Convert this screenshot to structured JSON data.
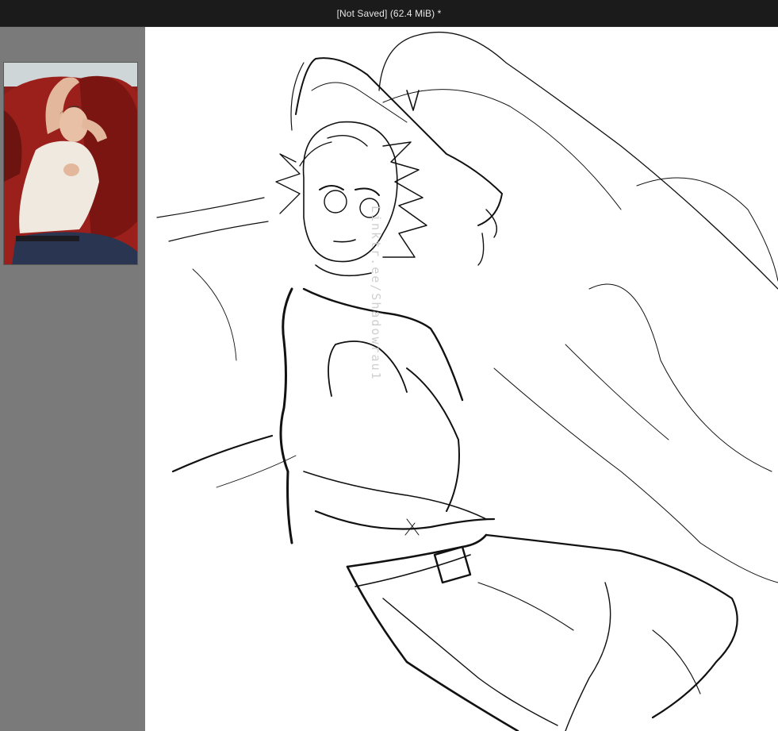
{
  "window": {
    "title": "[Not Saved]  (62.4 MiB) *"
  },
  "reference_panel": {
    "image": "reference-photo-person-lying-on-red-couch"
  },
  "canvas": {
    "watermark": "Linktr.ee/Shadowrau1"
  },
  "colors": {
    "titlebar": "#1b1b1b",
    "panel": "#7a7a7a",
    "canvas": "#ffffff",
    "ink": "#111111"
  }
}
